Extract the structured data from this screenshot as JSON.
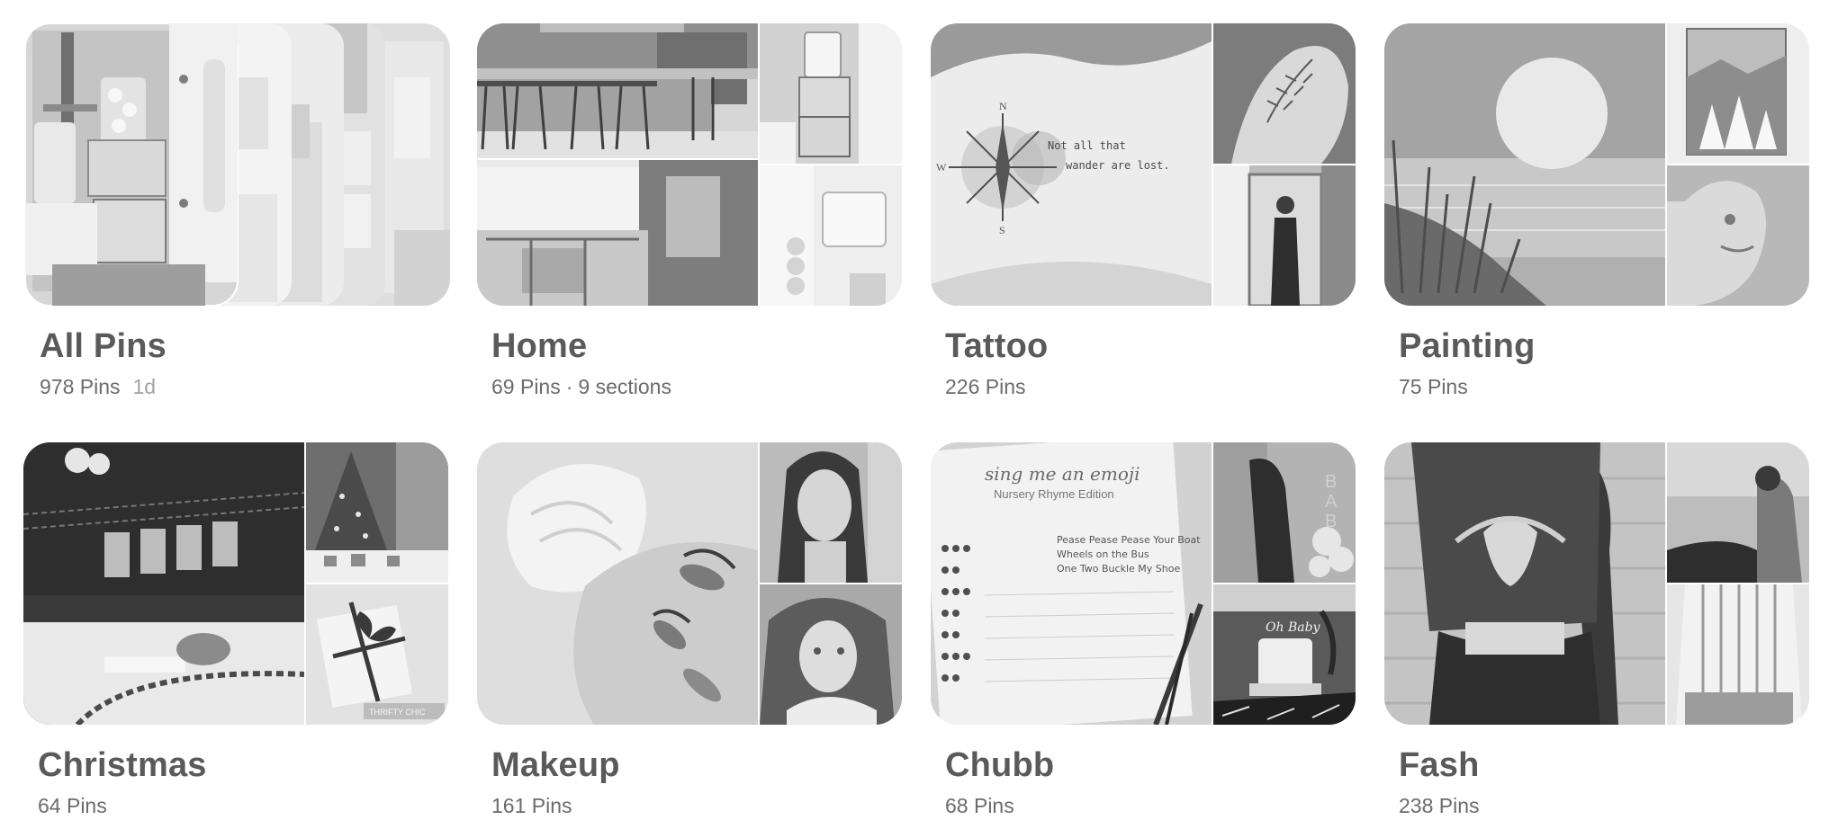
{
  "boards": [
    {
      "title": "All Pins",
      "count": "978 Pins",
      "updated": "1d"
    },
    {
      "title": "Home",
      "count": "69 Pins",
      "separator": "·",
      "sections": "9 sections"
    },
    {
      "title": "Tattoo",
      "count": "226 Pins",
      "image_text": {
        "line1": "Not all that",
        "line2": "wander are lost.",
        "compass_n": "N",
        "compass_w": "W",
        "compass_s": "S"
      }
    },
    {
      "title": "Painting",
      "count": "75 Pins"
    },
    {
      "title": "Christmas",
      "count": "64 Pins",
      "image_text": {
        "card": "THRIFTY CHIC"
      }
    },
    {
      "title": "Makeup",
      "count": "161 Pins"
    },
    {
      "title": "Chubb",
      "count": "68 Pins",
      "image_text": {
        "header1": "sing me an emoji",
        "header2": "Nursery Rhyme Edition",
        "line1": "Pease Pease Pease Your Boat",
        "line2": "Wheels on the Bus",
        "line3": "One Two Buckle My Shoe",
        "sign": "Oh Baby",
        "letter1": "B",
        "letter2": "A",
        "letter3": "B"
      }
    },
    {
      "title": "Fash",
      "count": "238 Pins"
    }
  ],
  "colors": {
    "background": "#ffffff",
    "title": "#5a5a5a",
    "meta": "#6b6b6b",
    "meta_faint": "#a3a3a3"
  },
  "icons": [
    "compass-tattoo-image",
    "moon-painting-image",
    "emoji-game-image"
  ]
}
